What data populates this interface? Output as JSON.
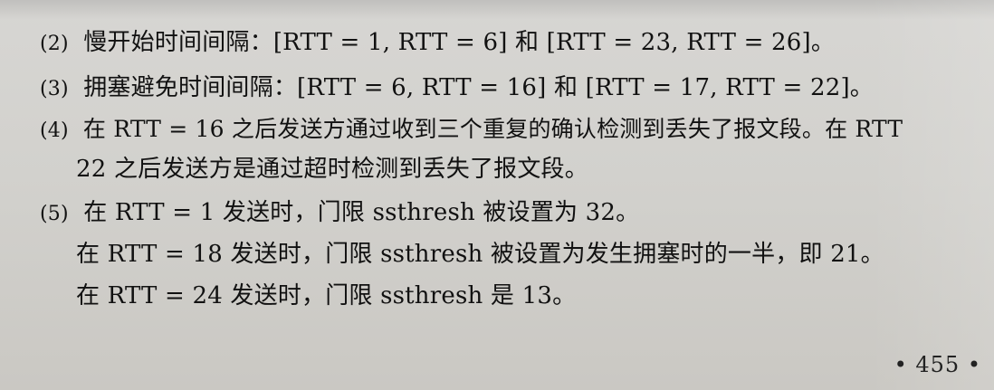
{
  "items": [
    {
      "number": "(2)",
      "text": "慢开始时间间隔：[RTT = 1, RTT = 6] 和 [RTT = 23, RTT = 26]。"
    },
    {
      "number": "(3)",
      "text": "拥塞避免时间间隔：[RTT = 6, RTT = 16] 和 [RTT = 17, RTT = 22]。"
    },
    {
      "number": "(4)",
      "text": "在 RTT = 16 之后发送方通过收到三个重复的确认检测到丢失了报文段。在 RTT",
      "continuation": "22 之后发送方是通过超时检测到丢失了报文段。"
    },
    {
      "number": "(5)",
      "text": "在 RTT = 1 发送时，门限 ssthresh 被设置为 32。",
      "lines": [
        "在 RTT = 18 发送时，门限 ssthresh 被设置为发生拥塞时的一半，即 21。",
        "在 RTT = 24 发送时，门限 ssthresh 是 13。"
      ]
    }
  ],
  "page_number": "• 455 •"
}
